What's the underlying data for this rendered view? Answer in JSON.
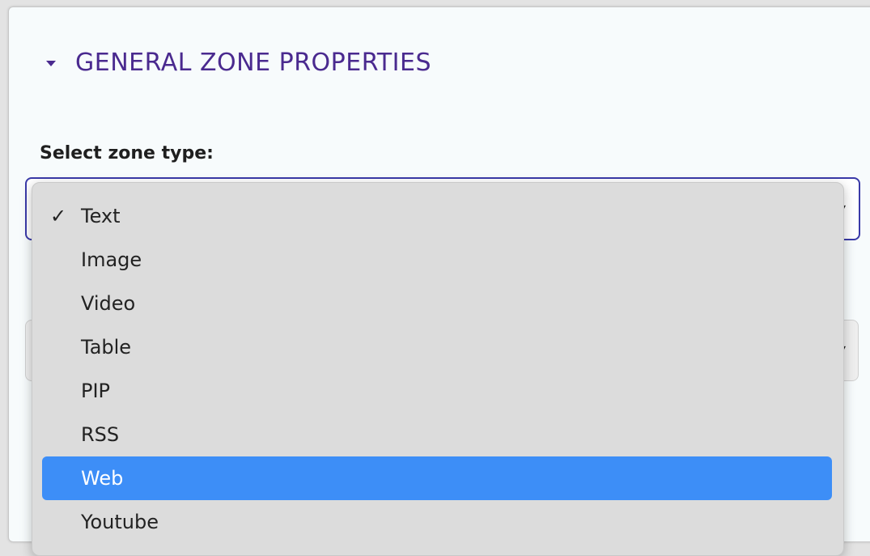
{
  "section": {
    "title": "GENERAL ZONE PROPERTIES"
  },
  "field": {
    "label": "Select zone type:"
  },
  "dropdown": {
    "selected": "Text",
    "highlighted": "Web",
    "options": [
      {
        "label": "Text",
        "checked": true
      },
      {
        "label": "Image",
        "checked": false
      },
      {
        "label": "Video",
        "checked": false
      },
      {
        "label": "Table",
        "checked": false
      },
      {
        "label": "PIP",
        "checked": false
      },
      {
        "label": "RSS",
        "checked": false
      },
      {
        "label": "Web",
        "checked": false
      },
      {
        "label": "Youtube",
        "checked": false
      }
    ],
    "check_glyph": "✓"
  },
  "colors": {
    "accent": "#4a2a8f",
    "highlight": "#3d8ef7",
    "menu_bg": "#dcdcdc"
  }
}
